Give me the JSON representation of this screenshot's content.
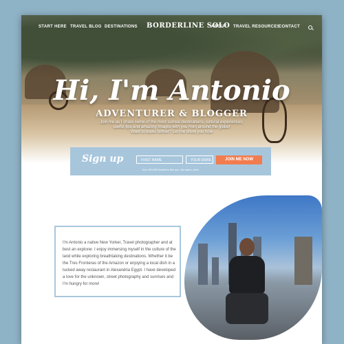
{
  "nav": {
    "left": [
      "START HERE",
      "TRAVEL BLOG",
      "DESTINATIONS"
    ],
    "logo": "BORDERLINE SOLO",
    "right": [
      "ABOUT",
      "TRAVEL RESOURCES",
      "CONTACT"
    ]
  },
  "hero": {
    "greeting": "Hi, I'm Antonio",
    "subtitle": "ADVENTURER & BLOGGER",
    "intro_line1": "Join me as I share some of the most surreal destinations, cultural experiences,",
    "intro_line2": "useful tips and amazing images with you from around the globe!",
    "intro_line3": "Want to travel farther? Let me show you how"
  },
  "signup": {
    "title": "Sign up",
    "first_name_placeholder": "FIRST NAME",
    "email_placeholder": "YOUR EMAIL",
    "button": "JOIN ME NOW",
    "note": "Join 100,000 travelers like you. No spam, ever."
  },
  "about": {
    "text": "I'm Antonio a native New Yorker, Travel photographer and at best an explorer. I enjoy immersing myself in the culture of the land while exploring breathtaking destinations. Whether it be the Tres Fronteras of the Amazon or enjoying a local dish in a tucked away restaurant in Alexandria Egypt. I have developed a love for the unknown, street photography and sunrises and I'm hungry for more!"
  },
  "colors": {
    "accent": "#f27b4f",
    "signup_bg": "#a7c6dc",
    "outer_bg": "#8fb3c6"
  }
}
